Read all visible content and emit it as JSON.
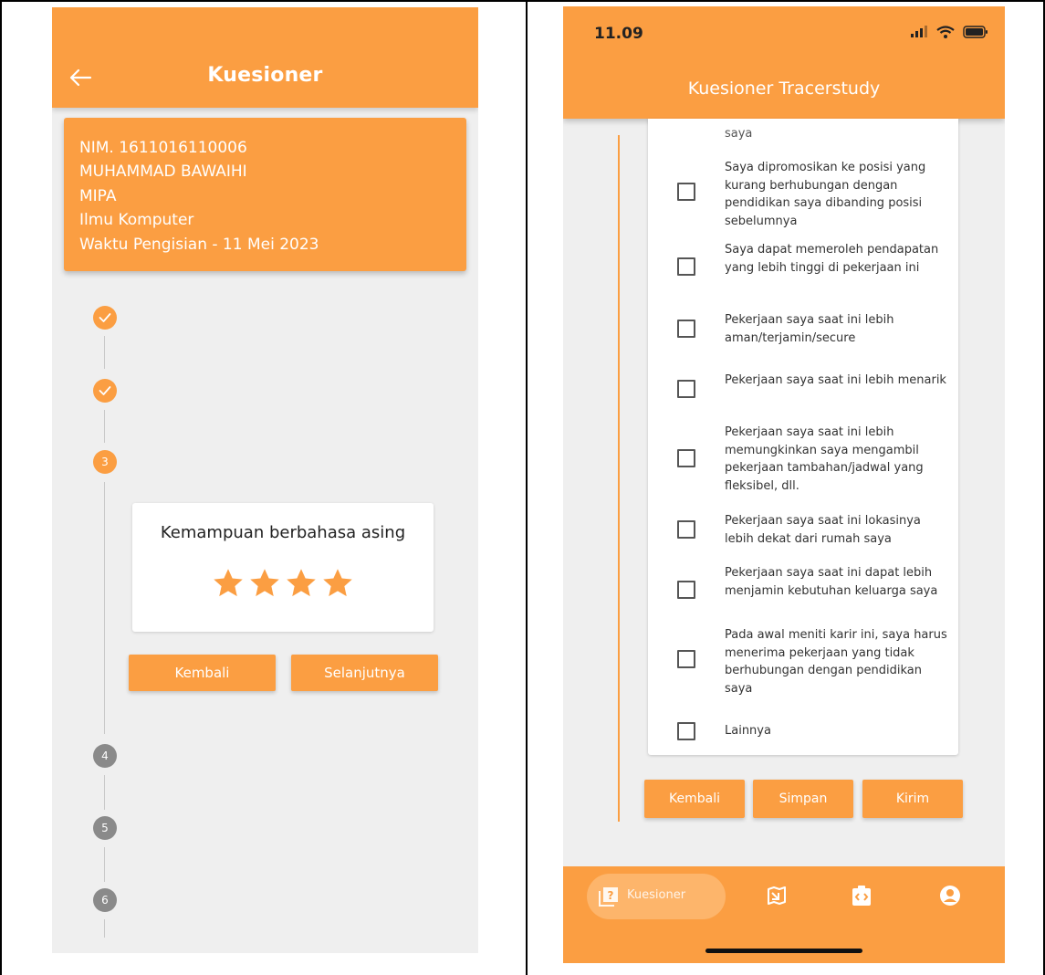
{
  "left": {
    "header": {
      "title": "Kuesioner",
      "back_icon": "arrow-left-icon"
    },
    "student": {
      "nim": "NIM. 1611016110006",
      "name": "MUHAMMAD BAWAIHI",
      "faculty": "MIPA",
      "program": "Ilmu Komputer",
      "filled": "Waktu Pengisian - 11 Mei 2023"
    },
    "steps": [
      {
        "state": "done",
        "label": ""
      },
      {
        "state": "done",
        "label": ""
      },
      {
        "state": "active",
        "label": "3"
      },
      {
        "state": "todo",
        "label": "4"
      },
      {
        "state": "todo",
        "label": "5"
      },
      {
        "state": "todo",
        "label": "6"
      }
    ],
    "rating": {
      "title": "Kemampuan berbahasa asing",
      "value": 4,
      "max": 4
    },
    "buttons": {
      "back": "Kembali",
      "next": "Selanjutnya"
    }
  },
  "right": {
    "status_bar": {
      "time": "11.09"
    },
    "header": {
      "title": "Kuesioner Tracerstudy"
    },
    "cut_text": "saya",
    "options": [
      {
        "label": "Saya dipromosikan ke posisi yang kurang berhubungan dengan pendidikan saya dibanding posisi sebelumnya",
        "checked": false
      },
      {
        "label": "Saya dapat memeroleh pendapatan yang lebih tinggi di pekerjaan ini",
        "checked": false
      },
      {
        "label": "Pekerjaan saya saat ini lebih aman/terjamin/secure",
        "checked": false
      },
      {
        "label": "Pekerjaan saya saat ini lebih menarik",
        "checked": false
      },
      {
        "label": "Pekerjaan saya saat ini lebih memungkinkan saya mengambil pekerjaan tambahan/jadwal yang fleksibel, dll.",
        "checked": false
      },
      {
        "label": "Pekerjaan saya saat ini lokasinya lebih dekat dari rumah saya",
        "checked": false
      },
      {
        "label": "Pekerjaan saya saat ini dapat lebih menjamin kebutuhan keluarga saya",
        "checked": false
      },
      {
        "label": "Pada awal meniti karir ini, saya harus menerima pekerjaan yang tidak berhubungan dengan pendidikan saya",
        "checked": false
      },
      {
        "label": "Lainnya",
        "checked": false
      }
    ],
    "buttons": {
      "back": "Kembali",
      "save": "Simpan",
      "submit": "Kirim"
    },
    "bottom_nav": {
      "active_label": "Kuesioner",
      "items": [
        "questionnaire-icon",
        "map-icon",
        "badge-icon",
        "profile-icon"
      ]
    }
  },
  "colors": {
    "accent": "#fb9e42",
    "todo_step": "#8a8a8a",
    "background": "#efefef"
  }
}
